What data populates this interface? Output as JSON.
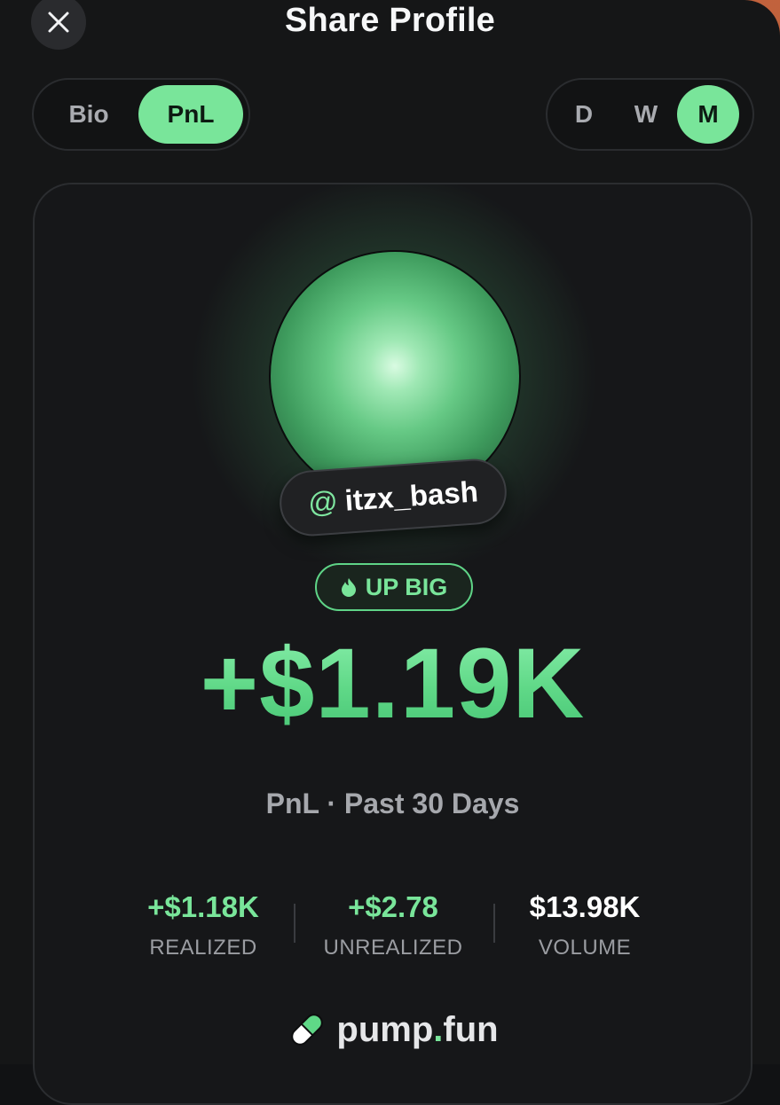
{
  "header": {
    "title": "Share Profile"
  },
  "tabs_left": [
    {
      "label": "Bio",
      "active": false
    },
    {
      "label": "PnL",
      "active": true
    }
  ],
  "tabs_right": [
    {
      "label": "D",
      "active": false
    },
    {
      "label": "W",
      "active": false
    },
    {
      "label": "M",
      "active": true
    }
  ],
  "card": {
    "handle_at": "@",
    "handle": "itzx_bash",
    "badge": "UP BIG",
    "pnl": "+$1.19K",
    "period": "PnL · Past 30 Days",
    "stats": [
      {
        "value": "+$1.18K",
        "label": "REALIZED"
      },
      {
        "value": "+$2.78",
        "label": "UNREALIZED"
      },
      {
        "value": "$13.98K",
        "label": "VOLUME"
      }
    ],
    "brand_left": "pump",
    "brand_dot": ".",
    "brand_right": "fun"
  },
  "colors": {
    "accent": "#79e59a",
    "background": "#151617",
    "corner": "#c4643e"
  },
  "icons": {
    "close": "close-icon",
    "badge": "flame-icon",
    "brand": "pill-icon"
  }
}
